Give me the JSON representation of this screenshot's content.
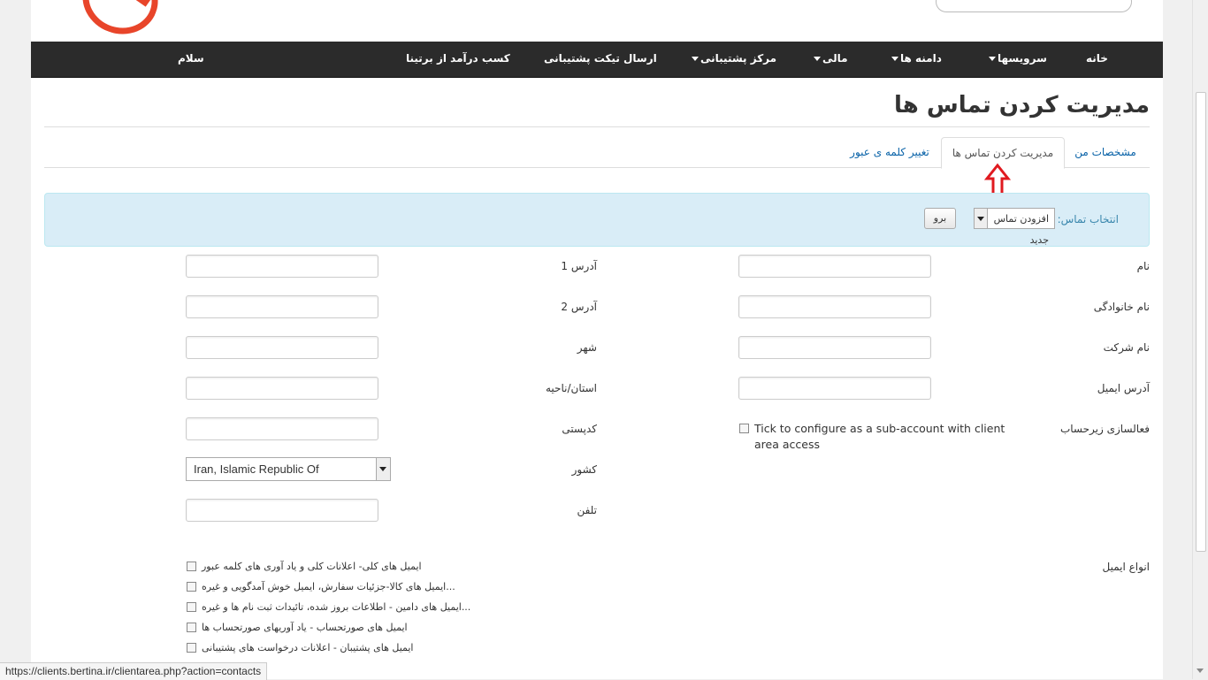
{
  "nav": {
    "home": "خانه",
    "services": "سرویسها",
    "domains": "دامنه ها",
    "billing": "مالی",
    "support": "مرکز پشتیبانی",
    "ticket": "ارسال تیکت پشتیبانی",
    "affiliate": "کسب درآمد از برتینا",
    "hello": "سلام"
  },
  "page_title": "مدیریت کردن تماس ها",
  "tabs": {
    "details": "مشخصات من",
    "contacts": "مدیریت کردن تماس ها",
    "password": "تغییر کلمه ی عبور"
  },
  "contact_select": {
    "label": "انتخاب تماس:",
    "value": "افزودن تماس جدید",
    "go": "برو"
  },
  "form": {
    "first_name": "نام",
    "last_name": "نام خانوادگی",
    "company": "نام شرکت",
    "email": "آدرس ایمیل",
    "subaccount": "فعالسازی زیرحساب",
    "subaccount_text": "Tick to configure as a sub-account with client area access",
    "address1": "آدرس 1",
    "address2": "آدرس 2",
    "city": "شهر",
    "state": "استان/ناحیه",
    "postcode": "کدپستی",
    "country": "کشور",
    "country_value": "Iran, Islamic Republic Of",
    "phone": "تلفن"
  },
  "email_types": {
    "label": "انواع ایمیل",
    "options": [
      "ایمیل های کلی- اعلانات کلی و یاد آوری های کلمه عبور",
      "...ایمیل های کالا-جزئیات سفارش، ایمیل خوش آمدگویی و غیره",
      "...ایمیل های دامین - اطلاعات بروز شده، تائیدات ثبت نام ها و غیره",
      "ایمیل های صورتحساب - یاد آوریهای صورتحساب ها",
      "ایمیل های پشتیبان - اعلانات درخواست های پشتیبانی"
    ]
  },
  "status_url": "https://clients.bertina.ir/clientarea.php?action=contacts",
  "colors": {
    "navbar": "#2b2b2b",
    "link": "#0a63a8",
    "alert_bg": "#d9edf7",
    "annotation_arrow": "#e0191f"
  }
}
